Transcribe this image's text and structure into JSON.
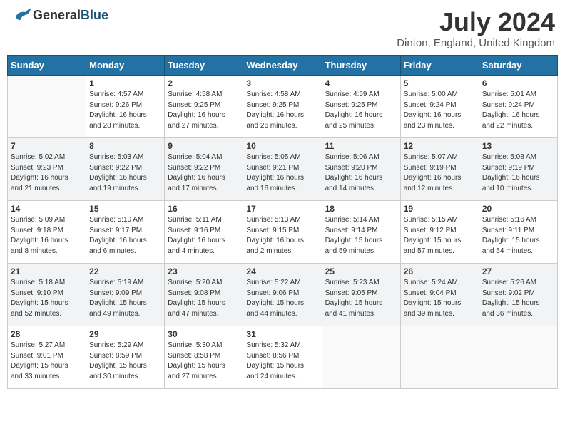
{
  "header": {
    "logo_general": "General",
    "logo_blue": "Blue",
    "month": "July 2024",
    "location": "Dinton, England, United Kingdom"
  },
  "days_of_week": [
    "Sunday",
    "Monday",
    "Tuesday",
    "Wednesday",
    "Thursday",
    "Friday",
    "Saturday"
  ],
  "weeks": [
    [
      {
        "day": "",
        "info": ""
      },
      {
        "day": "1",
        "info": "Sunrise: 4:57 AM\nSunset: 9:26 PM\nDaylight: 16 hours\nand 28 minutes."
      },
      {
        "day": "2",
        "info": "Sunrise: 4:58 AM\nSunset: 9:25 PM\nDaylight: 16 hours\nand 27 minutes."
      },
      {
        "day": "3",
        "info": "Sunrise: 4:58 AM\nSunset: 9:25 PM\nDaylight: 16 hours\nand 26 minutes."
      },
      {
        "day": "4",
        "info": "Sunrise: 4:59 AM\nSunset: 9:25 PM\nDaylight: 16 hours\nand 25 minutes."
      },
      {
        "day": "5",
        "info": "Sunrise: 5:00 AM\nSunset: 9:24 PM\nDaylight: 16 hours\nand 23 minutes."
      },
      {
        "day": "6",
        "info": "Sunrise: 5:01 AM\nSunset: 9:24 PM\nDaylight: 16 hours\nand 22 minutes."
      }
    ],
    [
      {
        "day": "7",
        "info": "Sunrise: 5:02 AM\nSunset: 9:23 PM\nDaylight: 16 hours\nand 21 minutes."
      },
      {
        "day": "8",
        "info": "Sunrise: 5:03 AM\nSunset: 9:22 PM\nDaylight: 16 hours\nand 19 minutes."
      },
      {
        "day": "9",
        "info": "Sunrise: 5:04 AM\nSunset: 9:22 PM\nDaylight: 16 hours\nand 17 minutes."
      },
      {
        "day": "10",
        "info": "Sunrise: 5:05 AM\nSunset: 9:21 PM\nDaylight: 16 hours\nand 16 minutes."
      },
      {
        "day": "11",
        "info": "Sunrise: 5:06 AM\nSunset: 9:20 PM\nDaylight: 16 hours\nand 14 minutes."
      },
      {
        "day": "12",
        "info": "Sunrise: 5:07 AM\nSunset: 9:19 PM\nDaylight: 16 hours\nand 12 minutes."
      },
      {
        "day": "13",
        "info": "Sunrise: 5:08 AM\nSunset: 9:19 PM\nDaylight: 16 hours\nand 10 minutes."
      }
    ],
    [
      {
        "day": "14",
        "info": "Sunrise: 5:09 AM\nSunset: 9:18 PM\nDaylight: 16 hours\nand 8 minutes."
      },
      {
        "day": "15",
        "info": "Sunrise: 5:10 AM\nSunset: 9:17 PM\nDaylight: 16 hours\nand 6 minutes."
      },
      {
        "day": "16",
        "info": "Sunrise: 5:11 AM\nSunset: 9:16 PM\nDaylight: 16 hours\nand 4 minutes."
      },
      {
        "day": "17",
        "info": "Sunrise: 5:13 AM\nSunset: 9:15 PM\nDaylight: 16 hours\nand 2 minutes."
      },
      {
        "day": "18",
        "info": "Sunrise: 5:14 AM\nSunset: 9:14 PM\nDaylight: 15 hours\nand 59 minutes."
      },
      {
        "day": "19",
        "info": "Sunrise: 5:15 AM\nSunset: 9:12 PM\nDaylight: 15 hours\nand 57 minutes."
      },
      {
        "day": "20",
        "info": "Sunrise: 5:16 AM\nSunset: 9:11 PM\nDaylight: 15 hours\nand 54 minutes."
      }
    ],
    [
      {
        "day": "21",
        "info": "Sunrise: 5:18 AM\nSunset: 9:10 PM\nDaylight: 15 hours\nand 52 minutes."
      },
      {
        "day": "22",
        "info": "Sunrise: 5:19 AM\nSunset: 9:09 PM\nDaylight: 15 hours\nand 49 minutes."
      },
      {
        "day": "23",
        "info": "Sunrise: 5:20 AM\nSunset: 9:08 PM\nDaylight: 15 hours\nand 47 minutes."
      },
      {
        "day": "24",
        "info": "Sunrise: 5:22 AM\nSunset: 9:06 PM\nDaylight: 15 hours\nand 44 minutes."
      },
      {
        "day": "25",
        "info": "Sunrise: 5:23 AM\nSunset: 9:05 PM\nDaylight: 15 hours\nand 41 minutes."
      },
      {
        "day": "26",
        "info": "Sunrise: 5:24 AM\nSunset: 9:04 PM\nDaylight: 15 hours\nand 39 minutes."
      },
      {
        "day": "27",
        "info": "Sunrise: 5:26 AM\nSunset: 9:02 PM\nDaylight: 15 hours\nand 36 minutes."
      }
    ],
    [
      {
        "day": "28",
        "info": "Sunrise: 5:27 AM\nSunset: 9:01 PM\nDaylight: 15 hours\nand 33 minutes."
      },
      {
        "day": "29",
        "info": "Sunrise: 5:29 AM\nSunset: 8:59 PM\nDaylight: 15 hours\nand 30 minutes."
      },
      {
        "day": "30",
        "info": "Sunrise: 5:30 AM\nSunset: 8:58 PM\nDaylight: 15 hours\nand 27 minutes."
      },
      {
        "day": "31",
        "info": "Sunrise: 5:32 AM\nSunset: 8:56 PM\nDaylight: 15 hours\nand 24 minutes."
      },
      {
        "day": "",
        "info": ""
      },
      {
        "day": "",
        "info": ""
      },
      {
        "day": "",
        "info": ""
      }
    ]
  ]
}
